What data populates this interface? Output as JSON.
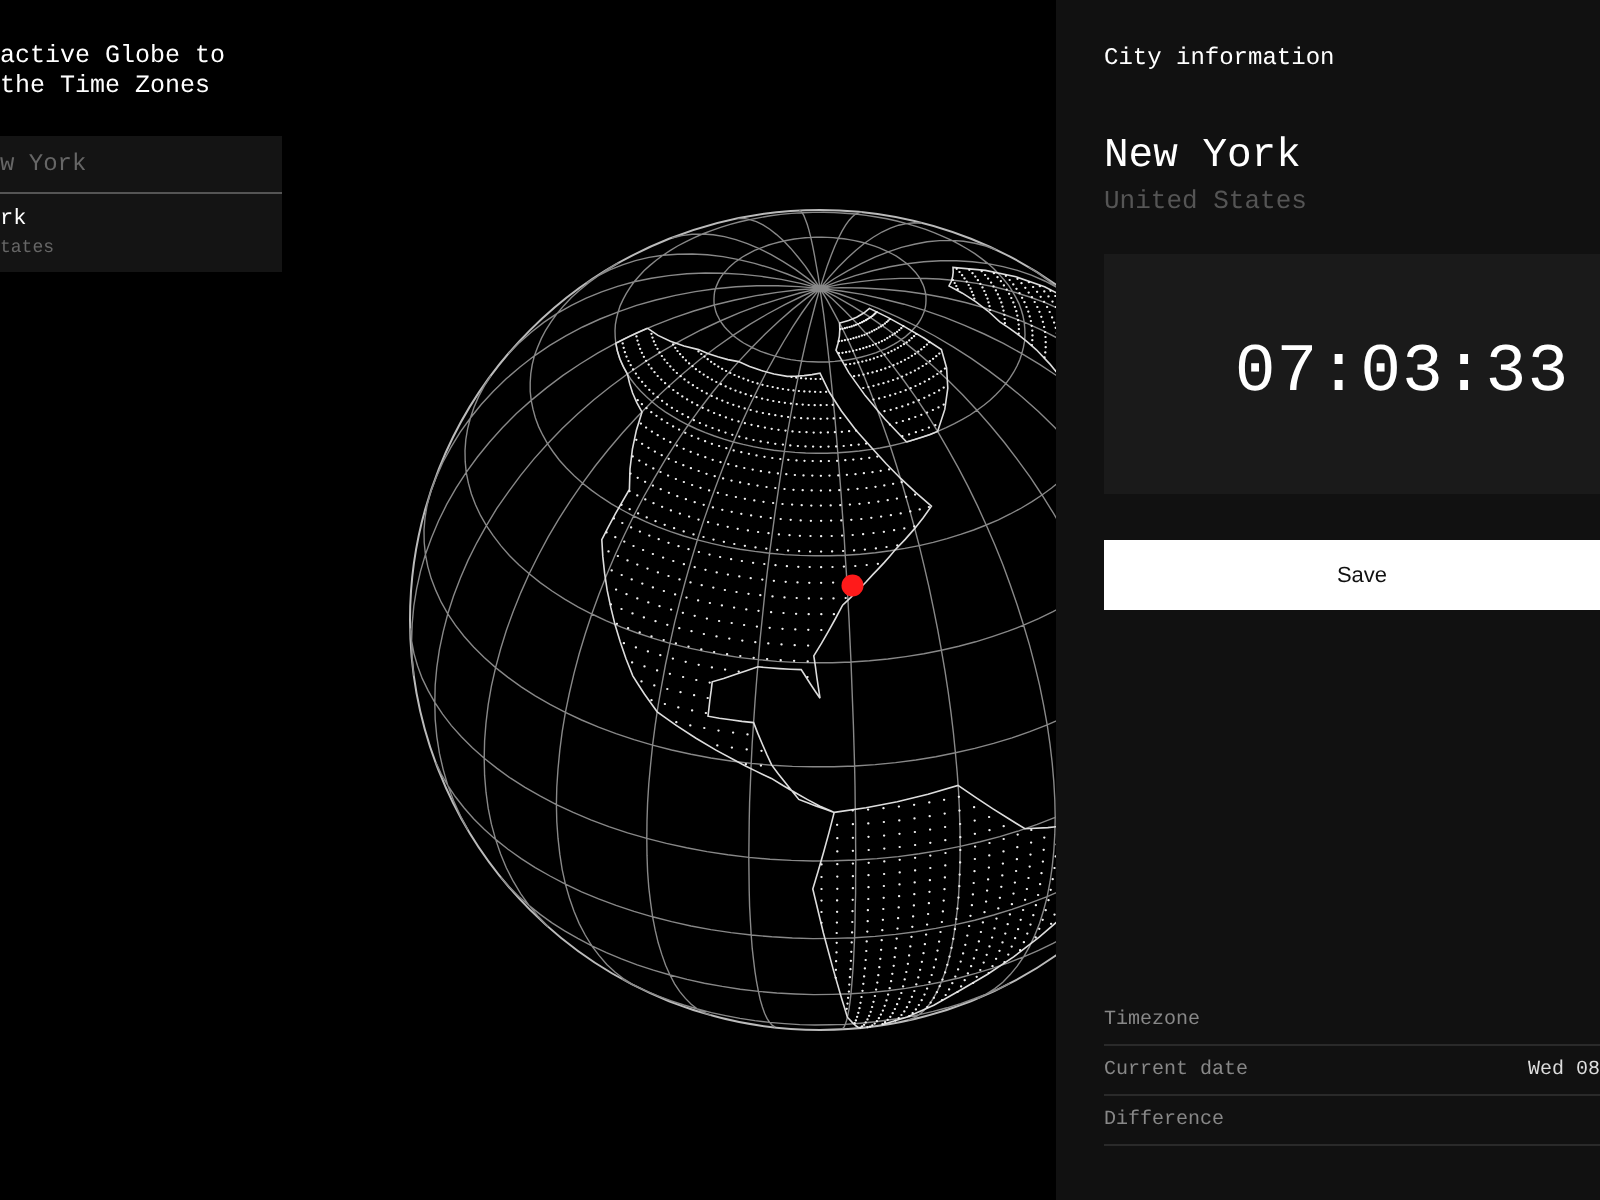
{
  "sidebar": {
    "title_lines": [
      "active Globe to",
      "the Time Zones"
    ],
    "search": {
      "value": "w York"
    },
    "results": [
      {
        "name": "rk",
        "country": "tates"
      }
    ]
  },
  "panel": {
    "heading": "City information",
    "city": "New York",
    "country": "United States",
    "clock": "07:03:33",
    "save_button": "Save",
    "details": [
      {
        "label": "Timezone"
      },
      {
        "label": "Current date",
        "value": "Wed 08"
      },
      {
        "label": "Difference"
      }
    ]
  }
}
